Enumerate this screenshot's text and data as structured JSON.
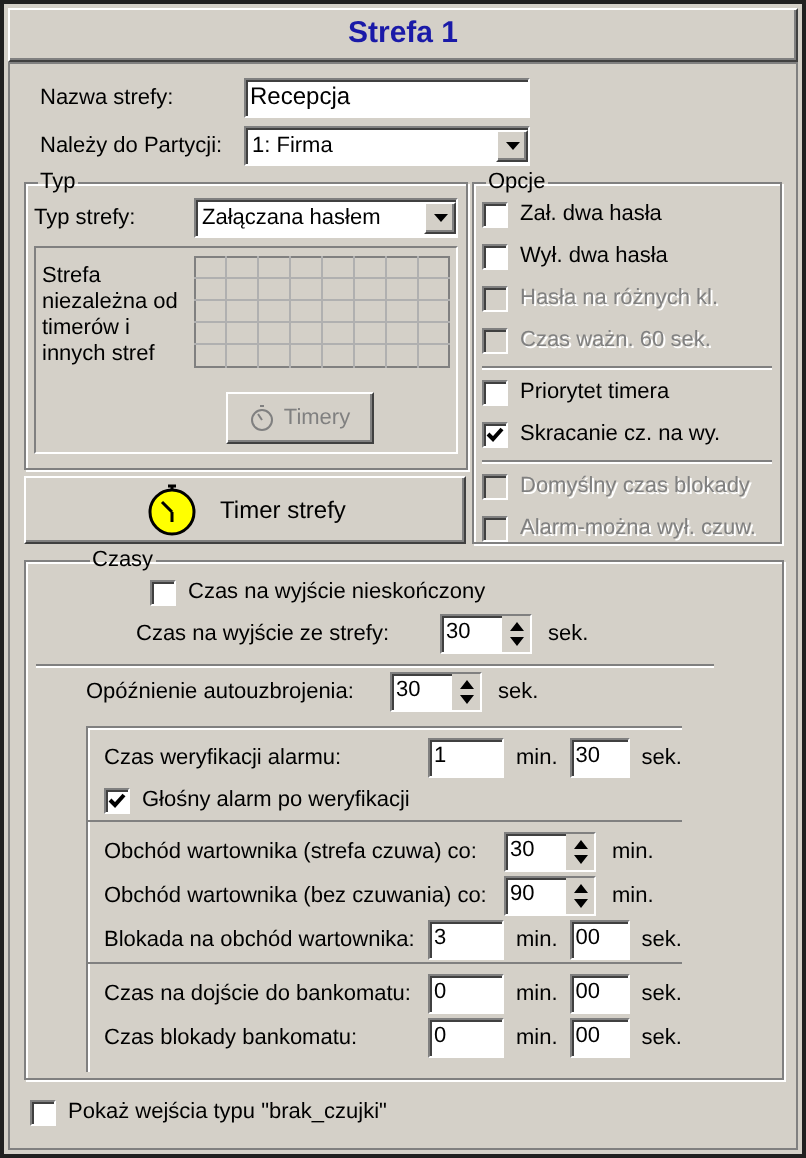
{
  "window": {
    "title": "Strefa 1"
  },
  "name_field": {
    "label": "Nazwa strefy:",
    "value": "Recepcja"
  },
  "partition_select": {
    "label": "Należy do Partycji:",
    "value": "1: Firma"
  },
  "typ": {
    "legend": "Typ",
    "label": "Typ strefy:",
    "value": "Załączana hasłem",
    "description": "Strefa niezależna od timerów i innych stref",
    "timers_button": {
      "label": "Timery",
      "disabled": true
    }
  },
  "timer_button": {
    "label": "Timer strefy"
  },
  "opcje": {
    "legend": "Opcje",
    "groups": [
      [
        {
          "label": "Zał. dwa hasła",
          "checked": false,
          "disabled": false
        },
        {
          "label": "Wył. dwa hasła",
          "checked": false,
          "disabled": false
        },
        {
          "label": "Hasła na różnych kl.",
          "checked": false,
          "disabled": true
        },
        {
          "label": "Czas ważn. 60 sek.",
          "checked": false,
          "disabled": true
        }
      ],
      [
        {
          "label": "Priorytet timera",
          "checked": false,
          "disabled": false
        },
        {
          "label": "Skracanie cz. na wy.",
          "checked": true,
          "disabled": false
        }
      ],
      [
        {
          "label": "Domyślny czas blokady",
          "checked": false,
          "disabled": true
        },
        {
          "label": "Alarm-można wył. czuw.",
          "checked": false,
          "disabled": true
        }
      ]
    ]
  },
  "czasy": {
    "legend": "Czasy",
    "sections": [
      [
        {
          "kind": "checkbox",
          "label": "Czas na wyjście nieskończony",
          "checked": false
        },
        {
          "kind": "spin",
          "label": "Czas na wyjście ze strefy:",
          "value": "30",
          "unit": "sek."
        }
      ],
      [
        {
          "kind": "spin",
          "label": "Opóźnienie autouzbrojenia:",
          "value": "30",
          "unit": "sek."
        }
      ]
    ],
    "panel": [
      [
        {
          "kind": "minsec",
          "label": "Czas weryfikacji alarmu:",
          "min": "1",
          "min_unit": "min.",
          "sec": "30",
          "sec_unit": "sek."
        },
        {
          "kind": "checkbox",
          "label": "Głośny alarm po weryfikacji",
          "checked": true
        }
      ],
      [
        {
          "kind": "spin",
          "label": "Obchód wartownika (strefa czuwa) co:",
          "value": "30",
          "unit": "min."
        },
        {
          "kind": "spin",
          "label": "Obchód wartownika (bez czuwania) co:",
          "value": "90",
          "unit": "min."
        },
        {
          "kind": "minsec",
          "label": "Blokada na obchód wartownika:",
          "min": "3",
          "min_unit": "min.",
          "sec": "00",
          "sec_unit": "sek."
        }
      ],
      [
        {
          "kind": "minsec",
          "label": "Czas na dojście do bankomatu:",
          "min": "0",
          "min_unit": "min.",
          "sec": "00",
          "sec_unit": "sek."
        },
        {
          "kind": "minsec",
          "label": "Czas blokady bankomatu:",
          "min": "0",
          "min_unit": "min.",
          "sec": "00",
          "sec_unit": "sek."
        }
      ]
    ]
  },
  "bottom_checkbox": {
    "label": "Pokaż wejścia typu \"brak_czujki\"",
    "checked": false
  }
}
